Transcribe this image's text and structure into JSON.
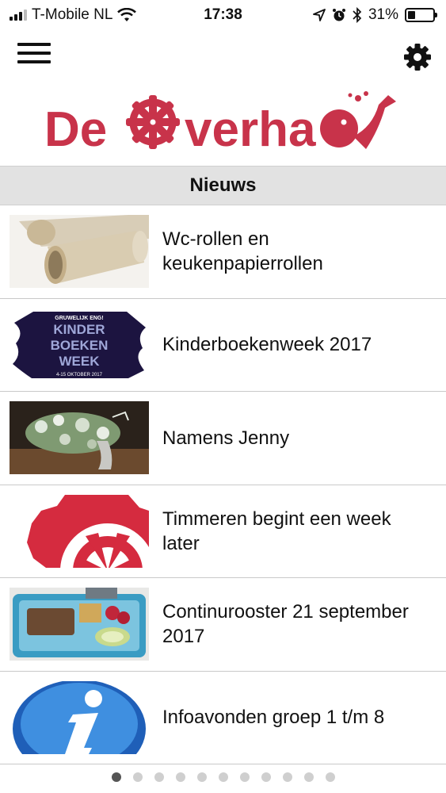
{
  "status_bar": {
    "carrier": "T-Mobile NL",
    "time": "17:38",
    "battery": "31%",
    "battery_level": 0.31
  },
  "header": {
    "menu_icon": "hamburger-menu-icon",
    "settings_icon": "gear-icon",
    "logo_text": "De Overhaal",
    "brand_color": "#c8334a"
  },
  "section": {
    "title": "Nieuws"
  },
  "news": [
    {
      "title": "Wc-rollen en keukenpapierrollen",
      "thumb": "paper-rolls-image"
    },
    {
      "title": "Kinderboekenweek 2017",
      "thumb": "kinderboekenweek-poster-image",
      "thumb_lines": [
        "GRUWELIJK ENG!",
        "KINDER",
        "BOEKEN",
        "WEEK",
        "4-15 OKTOBER 2017"
      ]
    },
    {
      "title": "Namens Jenny",
      "thumb": "flower-bouquet-image"
    },
    {
      "title": "Timmeren begint een week later",
      "thumb": "logo-wheel-image"
    },
    {
      "title": "Continurooster 21 september 2017",
      "thumb": "lunchbox-image"
    },
    {
      "title": "Infoavonden groep 1 t/m 8",
      "thumb": "info-icon-image"
    }
  ],
  "pagination": {
    "count": 11,
    "active": 0
  }
}
